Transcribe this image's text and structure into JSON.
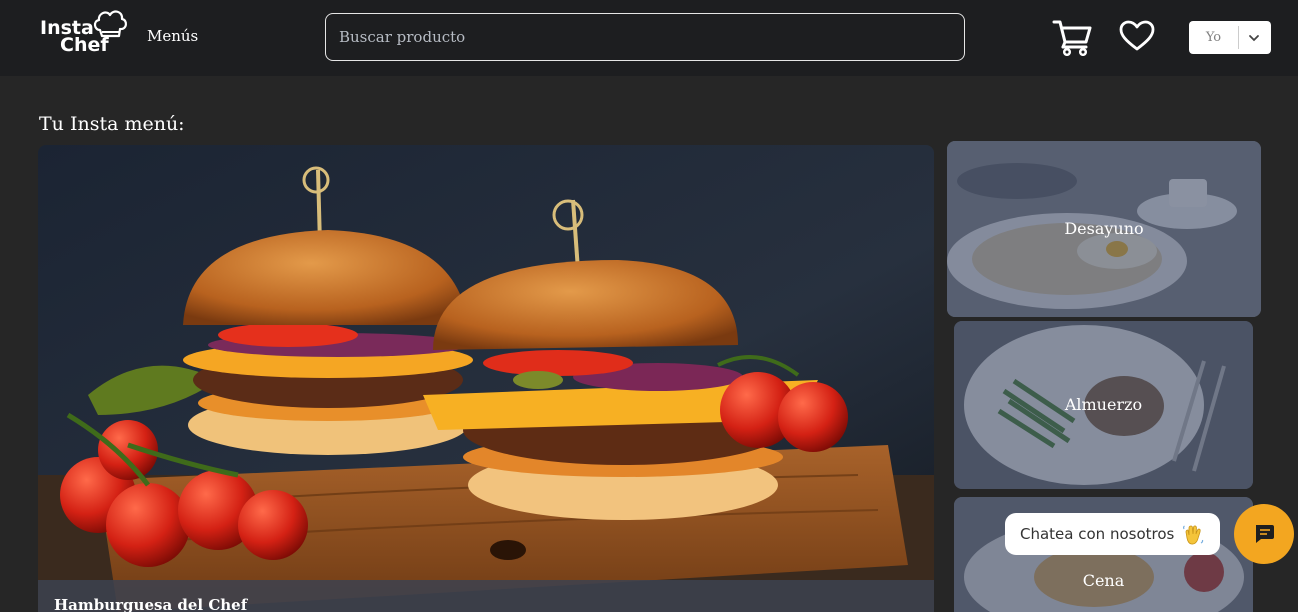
{
  "header": {
    "logo_line1": "Insta",
    "logo_line2": "Chef",
    "logo_icon": "chef-hat-icon",
    "nav_menus": "Menús",
    "search_placeholder": "Buscar producto",
    "cart_icon": "cart-icon",
    "favorites_icon": "heart-icon",
    "user_select_value": "Yo",
    "user_select_icon": "chevron-down-icon"
  },
  "main": {
    "section_title": "Tu Insta menú:",
    "hero_title": "Hamburguesa del Chef",
    "categories": [
      {
        "label": "Desayuno"
      },
      {
        "label": "Almuerzo"
      },
      {
        "label": "Cena"
      }
    ]
  },
  "chat": {
    "bubble_text": "Chatea con nosotros",
    "wave_icon": "waving-hand-icon",
    "button_icon": "chat-icon"
  },
  "colors": {
    "background": "#262626",
    "navbar": "#1d1e20",
    "chat_accent": "#f3a620",
    "caption_overlay": "#3c4250"
  }
}
